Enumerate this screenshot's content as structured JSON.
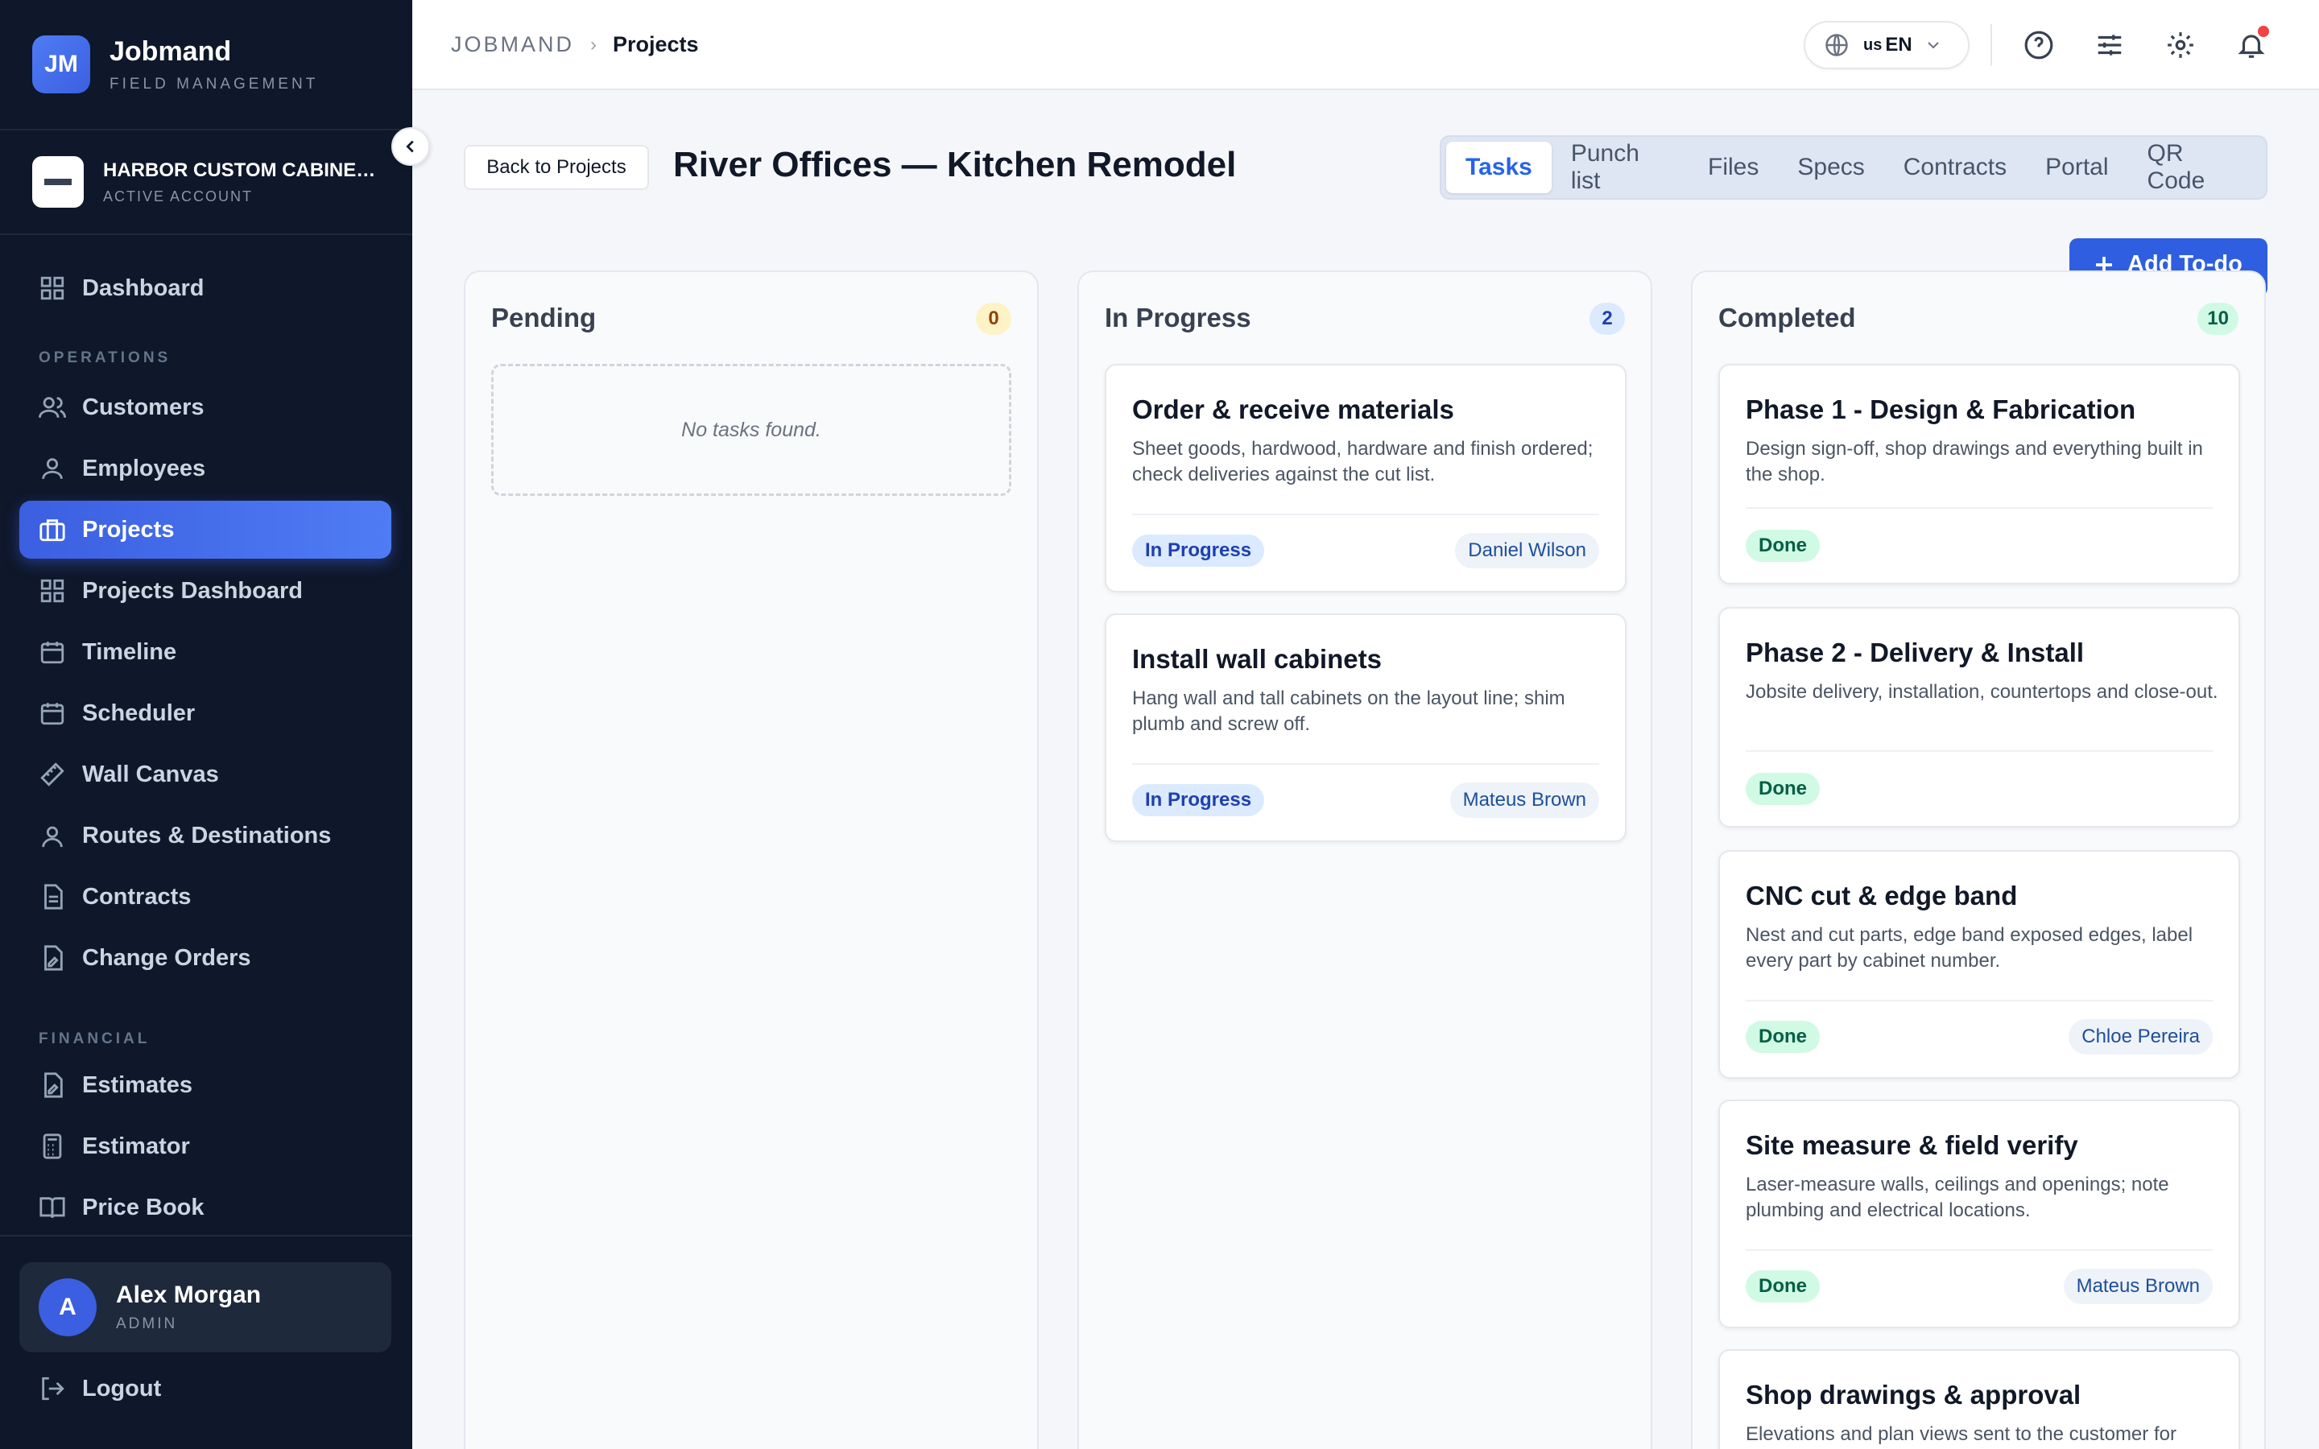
{
  "brand": {
    "logo": "JM",
    "title": "Jobmand",
    "subtitle": "FIELD MANAGEMENT"
  },
  "account": {
    "name": "HARBOR CUSTOM CABINETRY",
    "status": "ACTIVE ACCOUNT"
  },
  "nav": {
    "dashboard": "Dashboard",
    "section_operations": "OPERATIONS",
    "customers": "Customers",
    "employees": "Employees",
    "projects": "Projects",
    "projects_dashboard": "Projects Dashboard",
    "timeline": "Timeline",
    "scheduler": "Scheduler",
    "wall_canvas": "Wall Canvas",
    "routes": "Routes & Destinations",
    "contracts": "Contracts",
    "change_orders": "Change Orders",
    "section_financial": "FINANCIAL",
    "estimates": "Estimates",
    "estimator": "Estimator",
    "price_book": "Price Book"
  },
  "user": {
    "initial": "A",
    "name": "Alex Morgan",
    "role": "ADMIN"
  },
  "logout_label": "Logout",
  "breadcrumb": {
    "root": "JOBMAND",
    "current": "Projects"
  },
  "language": {
    "flag": "us",
    "code": "EN"
  },
  "page": {
    "back_label": "Back to Projects",
    "title": "River Offices — Kitchen Remodel",
    "tabs": [
      "Tasks",
      "Punch list",
      "Files",
      "Specs",
      "Contracts",
      "Portal",
      "QR Code"
    ],
    "add_label": "Add To-do"
  },
  "colors": {
    "accent": "#2f5fe0",
    "sidebar": "#0f172a",
    "pending_badge": "#fef3c7",
    "progress_badge": "#dbeafe",
    "done_badge": "#d1fae5"
  },
  "columns": {
    "pending": {
      "title": "Pending",
      "count": "0",
      "empty": "No tasks found."
    },
    "in_progress": {
      "title": "In Progress",
      "count": "2",
      "cards": [
        {
          "title": "Order & receive materials",
          "desc": "Sheet goods, hardwood, hardware and finish ordered; check deliveries against the cut list.",
          "status": "In Progress",
          "assignee": "Daniel Wilson"
        },
        {
          "title": "Install wall cabinets",
          "desc": "Hang wall and tall cabinets on the layout line; shim plumb and screw off.",
          "status": "In Progress",
          "assignee": "Mateus Brown"
        }
      ]
    },
    "completed": {
      "title": "Completed",
      "count": "10",
      "cards": [
        {
          "title": "Phase 1 - Design & Fabrication",
          "desc": "Design sign-off, shop drawings and everything built in the shop.",
          "status": "Done",
          "assignee": ""
        },
        {
          "title": "Phase 2 - Delivery & Install",
          "desc": "Jobsite delivery, installation, countertops and close-out.",
          "status": "Done",
          "assignee": ""
        },
        {
          "title": "CNC cut & edge band",
          "desc": "Nest and cut parts, edge band exposed edges, label every part by cabinet number.",
          "status": "Done",
          "assignee": "Chloe Pereira"
        },
        {
          "title": "Site measure & field verify",
          "desc": "Laser-measure walls, ceilings and openings; note plumbing and electrical locations.",
          "status": "Done",
          "assignee": "Mateus Brown"
        },
        {
          "title": "Shop drawings & approval",
          "desc": "Elevations and plan views sent to the customer for",
          "status": "",
          "assignee": ""
        }
      ]
    }
  }
}
